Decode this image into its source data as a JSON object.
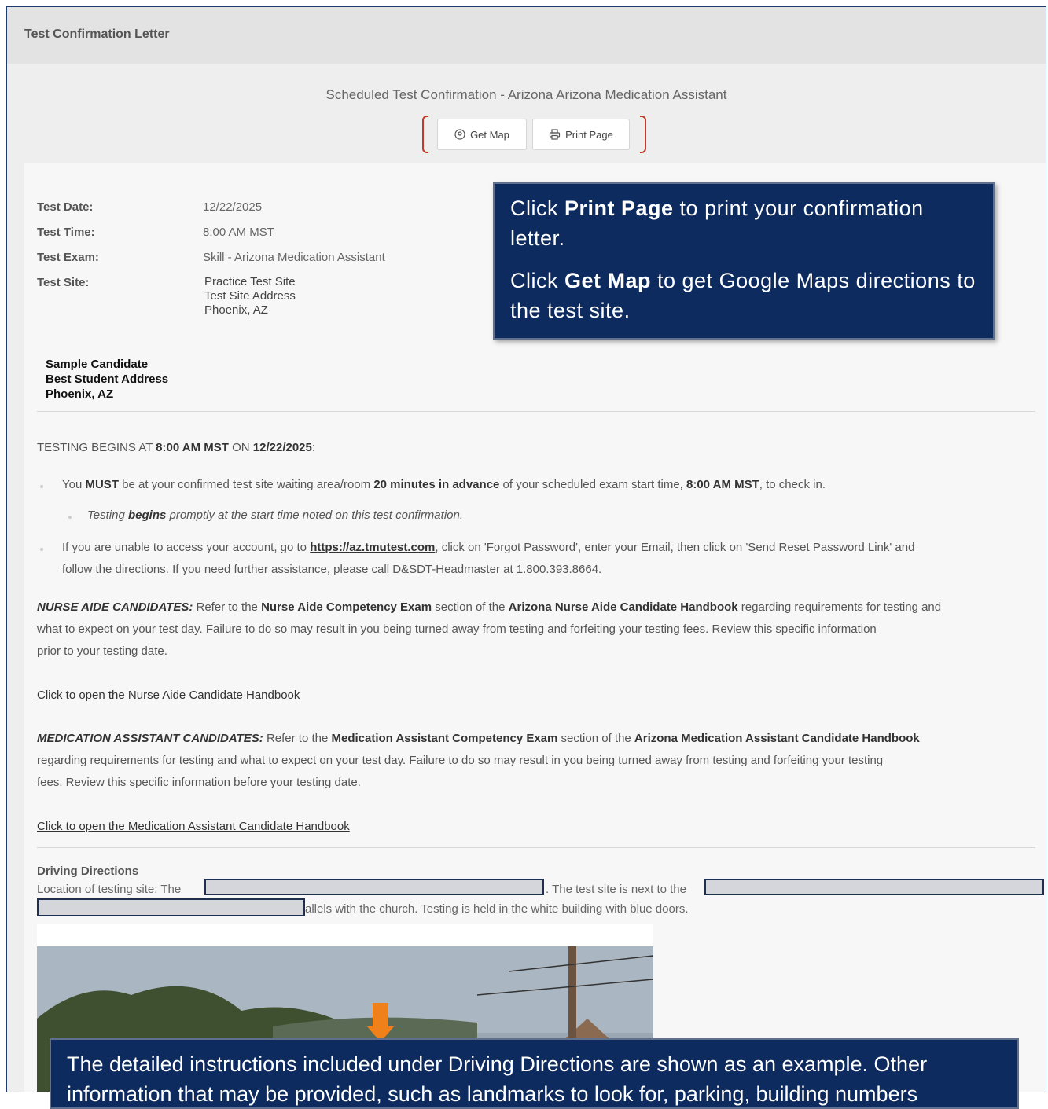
{
  "panel": {
    "title": "Test Confirmation Letter"
  },
  "header": {
    "subtitle": "Scheduled Test Confirmation - Arizona Arizona Medication Assistant"
  },
  "buttons": {
    "get_map": "Get Map",
    "print_page": "Print Page",
    "get_map_icon": "map-pin-icon",
    "print_icon": "printer-icon"
  },
  "details": [
    {
      "label": "Test Date:",
      "value": "12/22/2025"
    },
    {
      "label": "Test Time:",
      "value": "8:00 AM MST"
    },
    {
      "label": "Test Exam:",
      "value": "Skill - Arizona Medication Assistant"
    },
    {
      "label": "Test Site:",
      "value": ""
    }
  ],
  "test_site": [
    "Practice Test Site",
    "Test Site Address",
    "Phoenix, AZ"
  ],
  "candidate": [
    "Sample Candidate",
    "Best Student Address",
    "Phoenix, AZ"
  ],
  "testing_begins": {
    "prefix": "TESTING BEGINS AT ",
    "time": "8:00 AM MST",
    "mid": " ON ",
    "date": "12/22/2025",
    "suffix": ":"
  },
  "bullets": {
    "b1_a": "You ",
    "b1_must": "MUST",
    "b1_b": " be at your confirmed test site waiting area/room ",
    "b1_adv": "20 minutes in advance",
    "b1_c": " of your scheduled exam start time, ",
    "b1_time": "8:00 AM MST",
    "b1_d": ", to check in.",
    "sub_a": "Testing ",
    "sub_begins": "begins",
    "sub_b": " promptly at the start time noted on this test confirmation.",
    "b2_a": "If you are unable to access your account, go to ",
    "b2_link": "https://az.tmutest.com",
    "b2_b": ", click on 'Forgot Password', enter your Email, then click on 'Send Reset Password Link' and",
    "b2_line2": "follow the directions.  If you need further assistance, please call D&SDT-Headmaster at 1.800.393.8664."
  },
  "nurse": {
    "head": "NURSE AIDE CANDIDATES:",
    "a": "  Refer to the ",
    "exam": "Nurse Aide Competency Exam",
    "b": " section of the ",
    "handbook": "Arizona Nurse Aide Candidate Handbook",
    "c": " regarding requirements for testing and",
    "line2": "what to expect on your test day.  Failure to do so may result in you being turned away from testing and forfeiting your testing fees.  Review this specific information",
    "line3": "prior to your testing date.",
    "link": "Click to open the Nurse Aide Candidate Handbook"
  },
  "medication": {
    "head": "MEDICATION ASSISTANT CANDIDATES:",
    "a": " Refer to the ",
    "exam": "Medication Assistant Competency Exam",
    "b": " section of the ",
    "handbook": "Arizona Medication Assistant Candidate Handbook",
    "line2": "regarding requirements for testing and what to expect on your test day.  Failure to do so may result in you being turned away from testing and forfeiting your testing",
    "line3": "fees.  Review this specific information before your testing date.",
    "link": "Click to open the Medication Assistant Candidate Handbook"
  },
  "driving": {
    "title": "Driving Directions",
    "l1_a": "Location of testing site: The",
    "l1_b": ". The test site is next to the",
    "l2": "allels with the church. Testing is held in the white building with blue doors."
  },
  "callout_top": {
    "p1_a": "Click ",
    "p1_b": "Print Page",
    "p1_c": " to print your confirmation letter.",
    "p2_a": "Click ",
    "p2_b": "Get Map",
    "p2_c": " to get Google Maps directions to the test site."
  },
  "callout_bottom": {
    "line1": "The detailed instructions included under Driving Directions are shown as an example. Other",
    "line2": "information that may be provided, such as landmarks to look for, parking, building numbers"
  },
  "colors": {
    "callout_bg": "#0d2b5e",
    "frame_border": "#1f3a6e",
    "bracket": "#c0392b"
  }
}
